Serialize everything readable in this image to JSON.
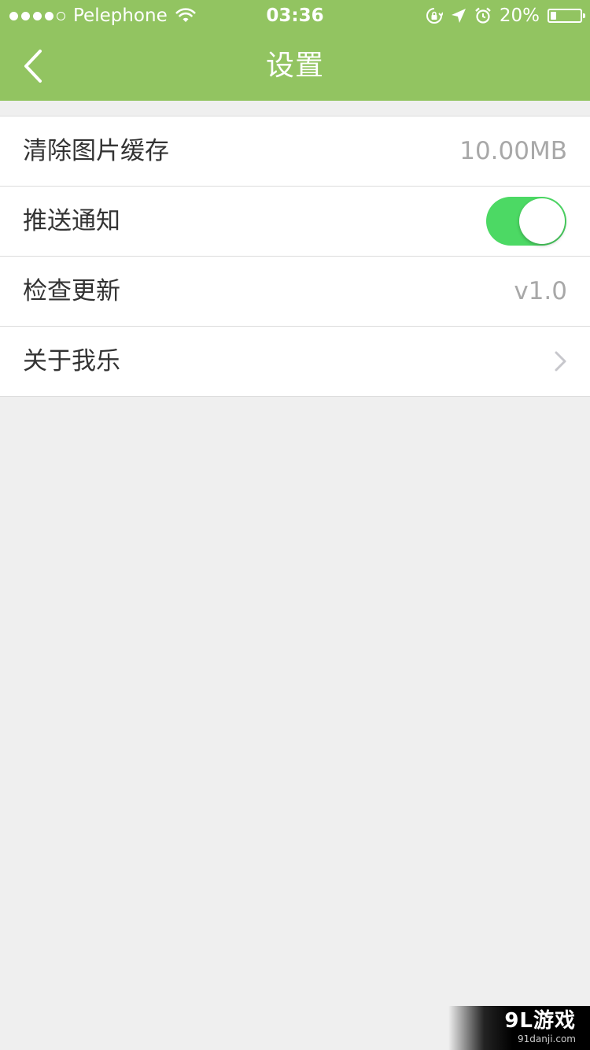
{
  "status_bar": {
    "carrier": "Pelephone",
    "signal_bars_filled": 4,
    "signal_bars_total": 5,
    "wifi_icon": "wifi-icon",
    "time": "03:36",
    "icons": [
      "rotation-lock-icon",
      "location-arrow-icon",
      "alarm-clock-icon"
    ],
    "battery_text": "20%",
    "battery_level": 0.2
  },
  "header": {
    "title": "设置",
    "back_icon": "chevron-left-icon",
    "background_color": "#92c461"
  },
  "settings": {
    "clear_cache": {
      "label": "清除图片缓存",
      "value": "10.00MB"
    },
    "push_notifications": {
      "label": "推送通知",
      "enabled": true,
      "toggle_on_color": "#4cd964"
    },
    "check_update": {
      "label": "检查更新",
      "value": "v1.0"
    },
    "about": {
      "label": "关于我乐",
      "icon": "chevron-right-icon"
    }
  },
  "watermark": {
    "brand": "9L游戏",
    "url": "91danji.com"
  }
}
